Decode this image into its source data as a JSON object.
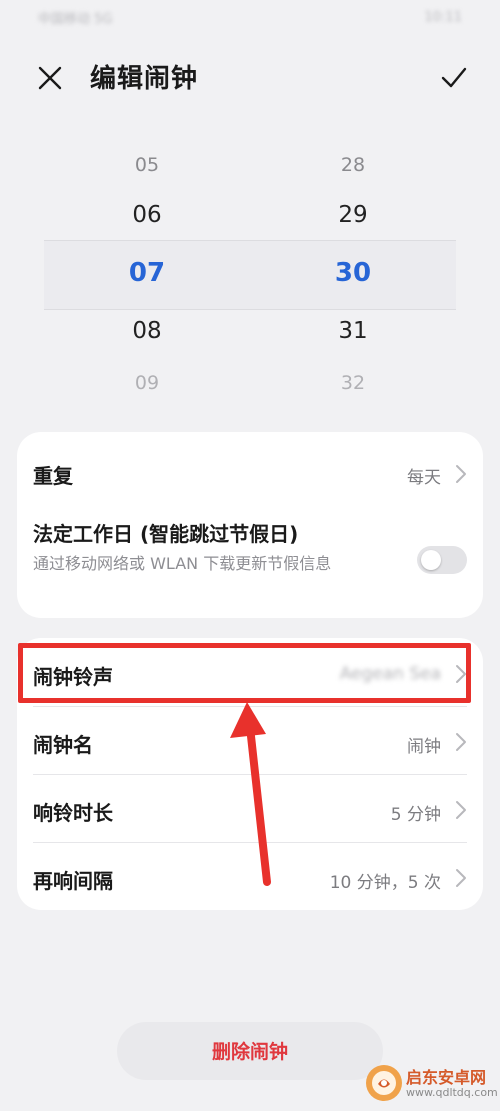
{
  "status_bar": {
    "carrier": "中国移动  5G",
    "time": "10:11"
  },
  "header": {
    "title": "编辑闹钟",
    "close_icon": "close-icon",
    "confirm_icon": "check-icon"
  },
  "time_picker": {
    "hours": [
      "05",
      "06",
      "07",
      "08",
      "09"
    ],
    "minutes": [
      "28",
      "29",
      "30",
      "31",
      "32"
    ],
    "selected_hour": "07",
    "selected_minute": "30",
    "selected_color": "#2765d6"
  },
  "settings_card1": {
    "repeat": {
      "label": "重复",
      "value": "每天"
    },
    "workday": {
      "label": "法定工作日 (智能跳过节假日)",
      "description": "通过移动网络或 WLAN 下载更新节假信息",
      "toggle_on": false
    }
  },
  "settings_card2": {
    "ringtone": {
      "label": "闹钟铃声",
      "value": "Aegean Sea"
    },
    "name": {
      "label": "闹钟名",
      "value": "闹钟"
    },
    "duration": {
      "label": "响铃时长",
      "value": "5 分钟"
    },
    "snooze": {
      "label": "再响间隔",
      "value": "10 分钟，5 次"
    }
  },
  "annotation": {
    "highlight_color": "#e8312c"
  },
  "delete_button": {
    "label": "删除闹钟",
    "color": "#e0383e"
  },
  "watermark": {
    "title": "启东安卓网",
    "url": "www.qdltdq.com"
  }
}
